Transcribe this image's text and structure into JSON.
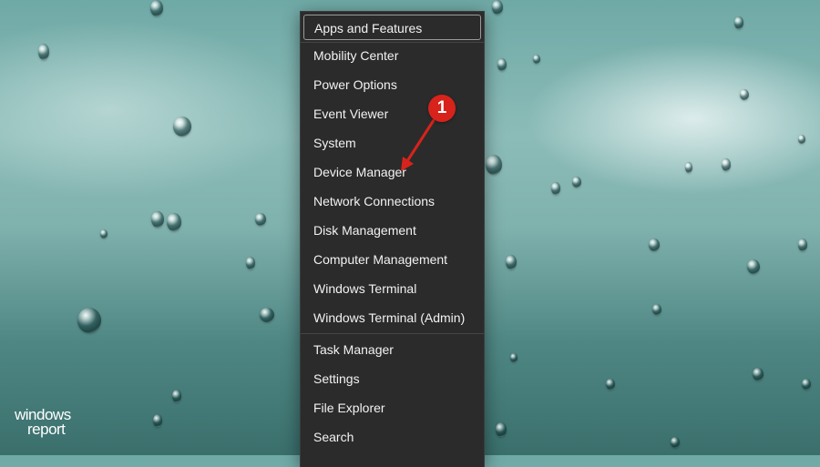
{
  "context_menu": {
    "items": [
      {
        "label": "Apps and Features",
        "selected": true
      },
      {
        "label": "Mobility Center"
      },
      {
        "label": "Power Options"
      },
      {
        "label": "Event Viewer"
      },
      {
        "label": "System"
      },
      {
        "label": "Device Manager"
      },
      {
        "label": "Network Connections"
      },
      {
        "label": "Disk Management"
      },
      {
        "label": "Computer Management"
      },
      {
        "label": "Windows Terminal"
      },
      {
        "label": "Windows Terminal (Admin)"
      },
      {
        "label": "Task Manager"
      },
      {
        "label": "Settings"
      },
      {
        "label": "File Explorer"
      },
      {
        "label": "Search"
      }
    ]
  },
  "annotation": {
    "step_number": "1",
    "color": "#d7231b"
  },
  "watermark": {
    "line1": "windows",
    "line2": "report"
  },
  "colors": {
    "menu_background": "#2b2b2b",
    "menu_text": "#f2f2f2"
  }
}
